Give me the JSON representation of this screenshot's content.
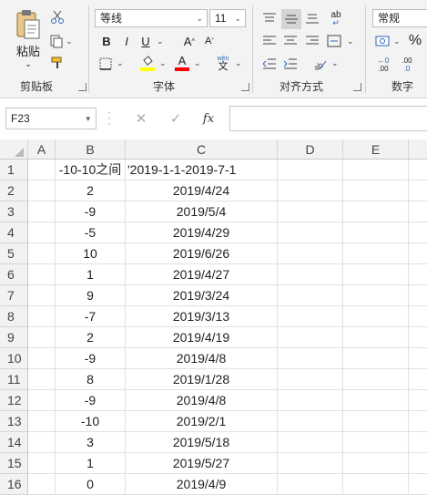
{
  "ribbon": {
    "clipboard": {
      "paste_label": "粘贴",
      "group_label": "剪贴板"
    },
    "font": {
      "font_name": "等线",
      "font_size": "11",
      "bold": "B",
      "italic": "I",
      "underline": "U",
      "grow": "A",
      "shrink": "A",
      "font_color_letter": "A",
      "phonetic_top": "wén",
      "phonetic_char": "文",
      "group_label": "字体"
    },
    "alignment": {
      "wrap_icon": "ab",
      "group_label": "对齐方式"
    },
    "number": {
      "format": "常规",
      "percent": "%",
      "dec_inc": ".00",
      "dec_dec": ".0",
      "group_label": "数字"
    }
  },
  "formula_bar": {
    "name_box": "F23",
    "fx": "fx",
    "formula": ""
  },
  "columns": [
    "A",
    "B",
    "C",
    "D",
    "E"
  ],
  "rows": [
    {
      "n": "1",
      "b": "-10-10之间",
      "c": "'2019-1-1-2019-7-1"
    },
    {
      "n": "2",
      "b": "2",
      "c": "2019/4/24"
    },
    {
      "n": "3",
      "b": "-9",
      "c": "2019/5/4"
    },
    {
      "n": "4",
      "b": "-5",
      "c": "2019/4/29"
    },
    {
      "n": "5",
      "b": "10",
      "c": "2019/6/26"
    },
    {
      "n": "6",
      "b": "1",
      "c": "2019/4/27"
    },
    {
      "n": "7",
      "b": "9",
      "c": "2019/3/24"
    },
    {
      "n": "8",
      "b": "-7",
      "c": "2019/3/13"
    },
    {
      "n": "9",
      "b": "2",
      "c": "2019/4/19"
    },
    {
      "n": "10",
      "b": "-9",
      "c": "2019/4/8"
    },
    {
      "n": "11",
      "b": "8",
      "c": "2019/1/28"
    },
    {
      "n": "12",
      "b": "-9",
      "c": "2019/4/8"
    },
    {
      "n": "13",
      "b": "-10",
      "c": "2019/2/1"
    },
    {
      "n": "14",
      "b": "3",
      "c": "2019/5/18"
    },
    {
      "n": "15",
      "b": "1",
      "c": "2019/5/27"
    },
    {
      "n": "16",
      "b": "0",
      "c": "2019/4/9"
    }
  ],
  "colors": {
    "ribbon_bg": "#f3f3f3",
    "highlight_yellow": "#ffff00",
    "font_red": "#ff0000",
    "header_bg": "#f2f2f2"
  }
}
